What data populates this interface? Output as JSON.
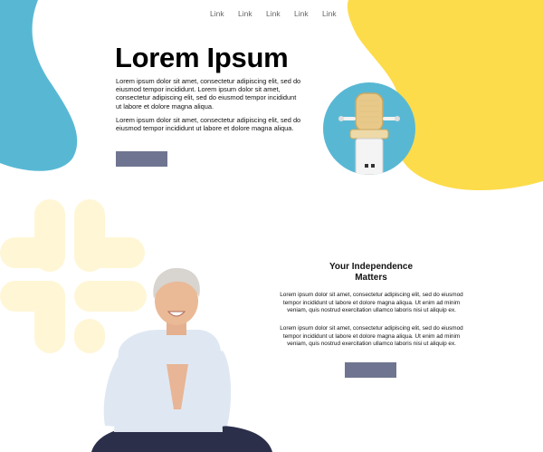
{
  "nav": {
    "links": [
      "Link",
      "Link",
      "Link",
      "Link",
      "Link"
    ]
  },
  "hero": {
    "title": "Lorem Ipsum",
    "paragraph1": "Lorem ipsum dolor sit amet, consectetur adipiscing elit, sed do eiusmod tempor incididunt. Lorem ipsum dolor sit amet, consectetur adipiscing elit, sed do eiusmod tempor incididunt ut labore et dolore magna aliqua.",
    "paragraph2": "Lorem ipsum dolor sit amet, consectetur adipiscing elit, sed do eiusmod tempor incididunt ut labore et dolore magna aliqua.",
    "button_label": ""
  },
  "section": {
    "title": "Your Independence Matters",
    "paragraph1": "Lorem ipsum dolor sit amet, consectetur adipiscing elit, sed do eiusmod tempor incididunt ut labore et dolore magna aliqua. Ut enim ad minim veniam, quis nostrud exercitation ullamco laboris nisi ut aliquip ex.",
    "paragraph2": "Lorem ipsum dolor sit amet, consectetur adipiscing elit, sed do eiusmod tempor incididunt ut labore et dolore magna aliqua. Ut enim ad minim veniam, quis nostrud exercitation ullamco laboris nisi ut aliquip ex.",
    "button_label": ""
  },
  "colors": {
    "blue": "#58b8d4",
    "yellow": "#fddc4b",
    "button": "#6f7590",
    "decor": "#fff6d6"
  },
  "icons": {
    "decoration": "slack-logo-icon"
  }
}
